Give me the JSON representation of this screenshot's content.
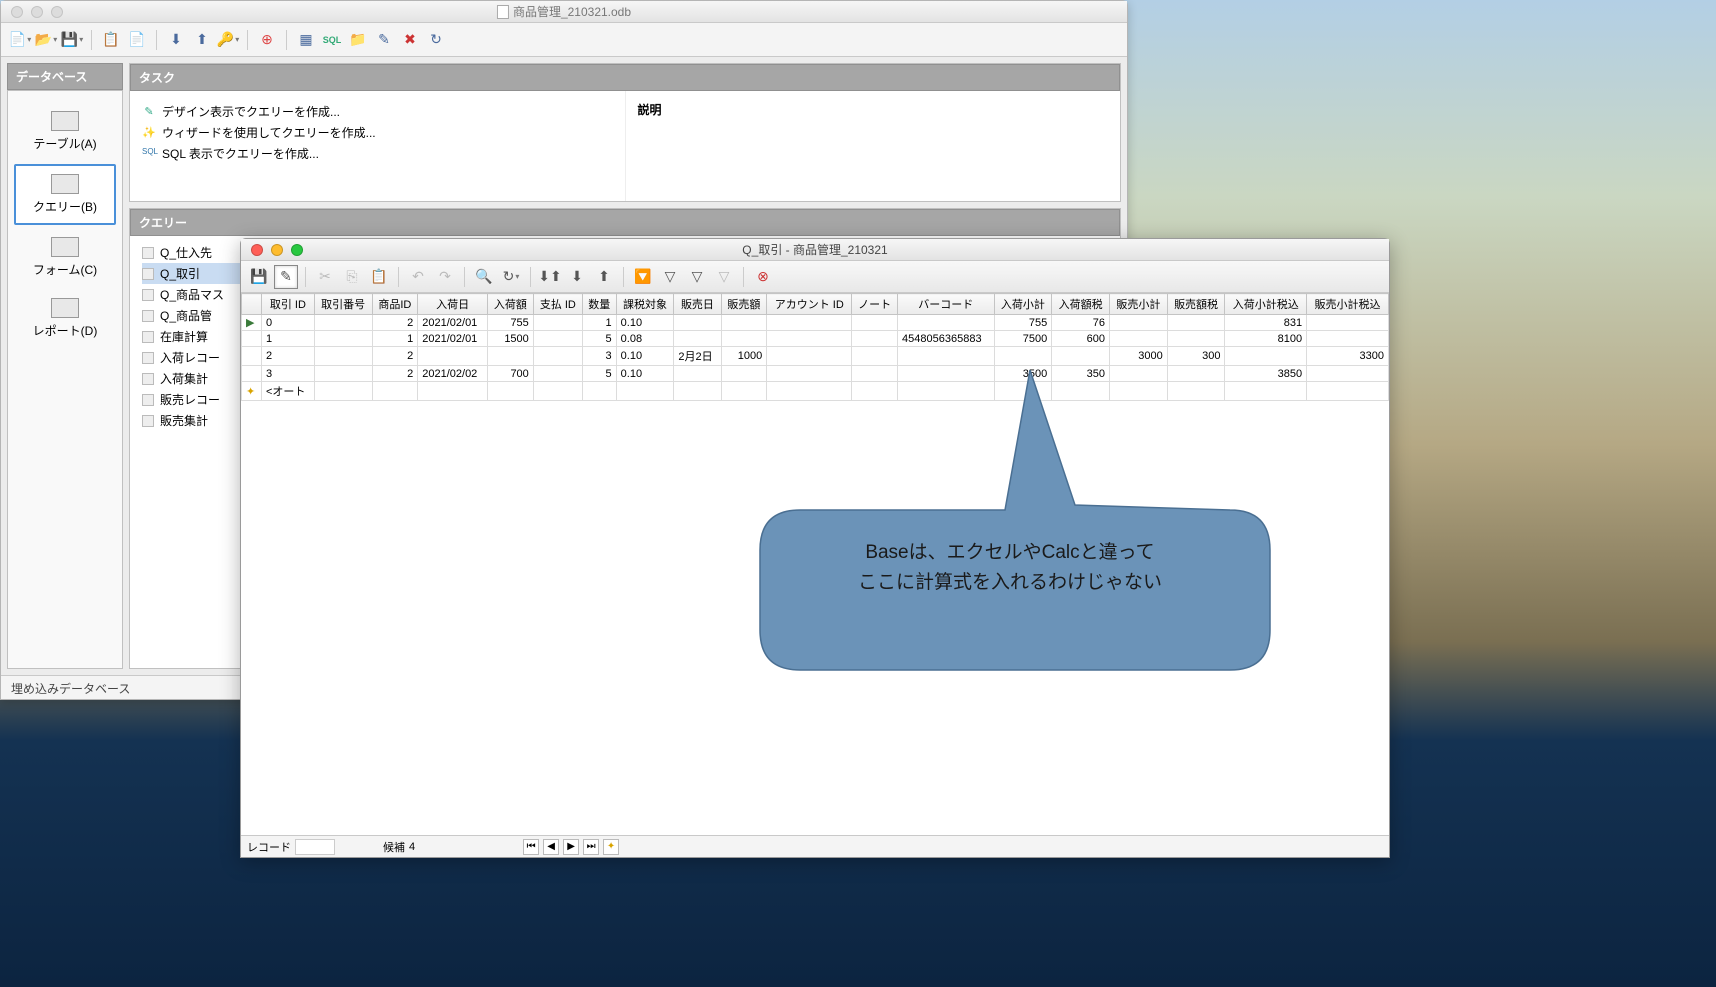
{
  "main_window": {
    "title": "商品管理_210321.odb",
    "sidebar": {
      "header": "データベース",
      "items": [
        {
          "label": "テーブル(A)"
        },
        {
          "label": "クエリー(B)"
        },
        {
          "label": "フォーム(C)"
        },
        {
          "label": "レポート(D)"
        }
      ]
    },
    "tasks": {
      "header": "タスク",
      "items": [
        "デザイン表示でクエリーを作成...",
        "ウィザードを使用してクエリーを作成...",
        "SQL 表示でクエリーを作成..."
      ],
      "desc_label": "説明"
    },
    "queries": {
      "header": "クエリー",
      "items": [
        "Q_仕入先",
        "Q_取引",
        "Q_商品マス",
        "Q_商品管",
        "在庫計算",
        "入荷レコー",
        "入荷集計",
        "販売レコー",
        "販売集計"
      ]
    },
    "status": "埋め込みデータベース"
  },
  "data_window": {
    "title": "Q_取引 - 商品管理_210321",
    "columns": [
      "取引 ID",
      "取引番号",
      "商品ID",
      "入荷日",
      "入荷額",
      "支払 ID",
      "数量",
      "課税対象",
      "販売日",
      "販売額",
      "アカウント ID",
      "ノート",
      "バーコード",
      "入荷小計",
      "入荷額税",
      "販売小計",
      "販売額税",
      "入荷小計税込",
      "販売小計税込"
    ],
    "rows": [
      {
        "id": "0",
        "num": "",
        "pid": "2",
        "indate": "2021/02/01",
        "inamt": "755",
        "payid": "",
        "qty": "1",
        "tax": "0.10",
        "saledate": "",
        "saleamt": "",
        "acct": "",
        "note": "",
        "barcode": "",
        "insub": "755",
        "intax": "76",
        "salesub": "",
        "saletax": "",
        "insubtax": "831",
        "salesubtax": ""
      },
      {
        "id": "1",
        "num": "",
        "pid": "1",
        "indate": "2021/02/01",
        "inamt": "1500",
        "payid": "",
        "qty": "5",
        "tax": "0.08",
        "saledate": "",
        "saleamt": "",
        "acct": "",
        "note": "",
        "barcode": "4548056365883",
        "insub": "7500",
        "intax": "600",
        "salesub": "",
        "saletax": "",
        "insubtax": "8100",
        "salesubtax": ""
      },
      {
        "id": "2",
        "num": "",
        "pid": "2",
        "indate": "",
        "inamt": "",
        "payid": "",
        "qty": "3",
        "tax": "0.10",
        "saledate": "2月2日",
        "saleamt": "1000",
        "acct": "",
        "note": "",
        "barcode": "",
        "insub": "",
        "intax": "",
        "salesub": "3000",
        "saletax": "300",
        "insubtax": "",
        "salesubtax": "3300"
      },
      {
        "id": "3",
        "num": "",
        "pid": "2",
        "indate": "2021/02/02",
        "inamt": "700",
        "payid": "",
        "qty": "5",
        "tax": "0.10",
        "saledate": "",
        "saleamt": "",
        "acct": "",
        "note": "",
        "barcode": "",
        "insub": "3500",
        "intax": "350",
        "salesub": "",
        "saletax": "",
        "insubtax": "3850",
        "salesubtax": ""
      }
    ],
    "auto_row": "<オート",
    "status": {
      "record_label": "レコード",
      "record_val": "",
      "candidates_label": "候補",
      "candidates_val": "4"
    }
  },
  "callout": {
    "line1": "Baseは、エクセルやCalcと違って",
    "line2": "ここに計算式を入れるわけじゃない"
  }
}
